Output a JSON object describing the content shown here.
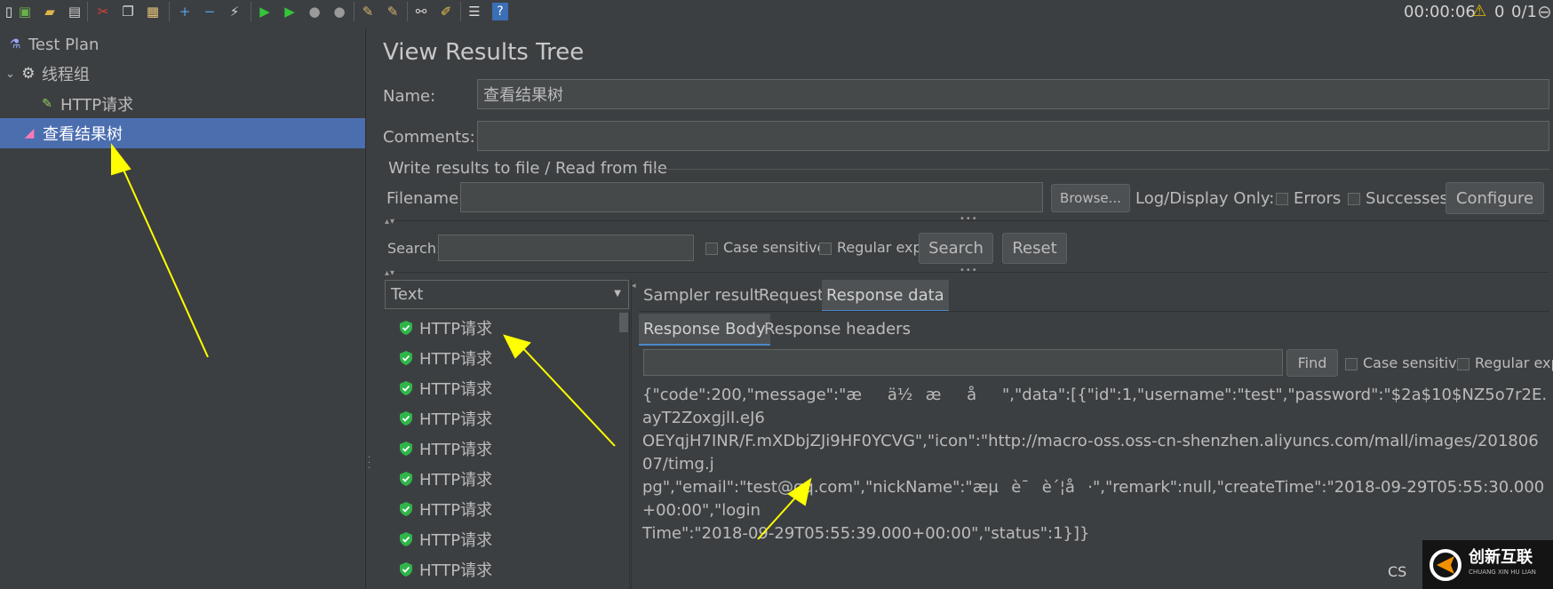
{
  "toolbar": {
    "timer": "00:00:06",
    "warning_count": "0",
    "thread_ratio": "0/1"
  },
  "tree": {
    "items": [
      {
        "label": "Test Plan"
      },
      {
        "label": "线程组"
      },
      {
        "label": "HTTP请求"
      },
      {
        "label": "查看结果树"
      }
    ]
  },
  "panel": {
    "title": "View Results Tree",
    "name_label": "Name:",
    "name_value": "查看结果树",
    "comments_label": "Comments:",
    "file_section_title": "Write results to file / Read from file",
    "filename_label": "Filename",
    "browse_label": "Browse...",
    "log_display_label": "Log/Display Only:",
    "errors_label": "Errors",
    "successes_label": "Successes",
    "configure_label": "Configure"
  },
  "search": {
    "label": "Search:",
    "case_sensitive_label": "Case sensitive",
    "regular_exp_label": "Regular exp.",
    "search_button": "Search",
    "reset_button": "Reset"
  },
  "renderer": {
    "selected": "Text"
  },
  "results": {
    "items": [
      "HTTP请求",
      "HTTP请求",
      "HTTP请求",
      "HTTP请求",
      "HTTP请求",
      "HTTP请求",
      "HTTP请求",
      "HTTP请求",
      "HTTP请求"
    ]
  },
  "tabs": {
    "main": [
      "Sampler result",
      "Request",
      "Response data"
    ],
    "sub": [
      "Response Body",
      "Response headers"
    ]
  },
  "find": {
    "button": "Find",
    "case_sensitive_label": "Case sensitive",
    "regular_exp_label": "Regular exp."
  },
  "response": {
    "lines": [
      "{\"code\":200,\"message\":\"æä½æå\",\"data\":[{\"id\":1,\"username\":\"test\",\"password\":\"$2a$10$NZ5o7r2E.ayT2ZoxgjlI.eJ6",
      "OEYqjH7INR/F.mXDbjZJi9HF0YCVG\",\"icon\":\"http://macro-oss.oss-cn-shenzhen.aliyuncs.com/mall/images/20180607/timg.j",
      "pg\",\"email\":\"test@qq.com\",\"nickName\":\"æµè¯è´¦å·\",\"remark\":null,\"createTime\":\"2018-09-29T05:55:30.000+00:00\",\"login",
      "Time\":\"2018-09-29T05:55:39.000+00:00\",\"status\":1}]}"
    ]
  },
  "watermark": {
    "text": "创新互联",
    "sub": "CHUANG XIN HU LIAN",
    "partial": "CS"
  },
  "colors": {
    "background": "#3c3f41",
    "selection": "#4b6eaf",
    "arrow": "#ffff00",
    "shield": "#2fb54a"
  }
}
